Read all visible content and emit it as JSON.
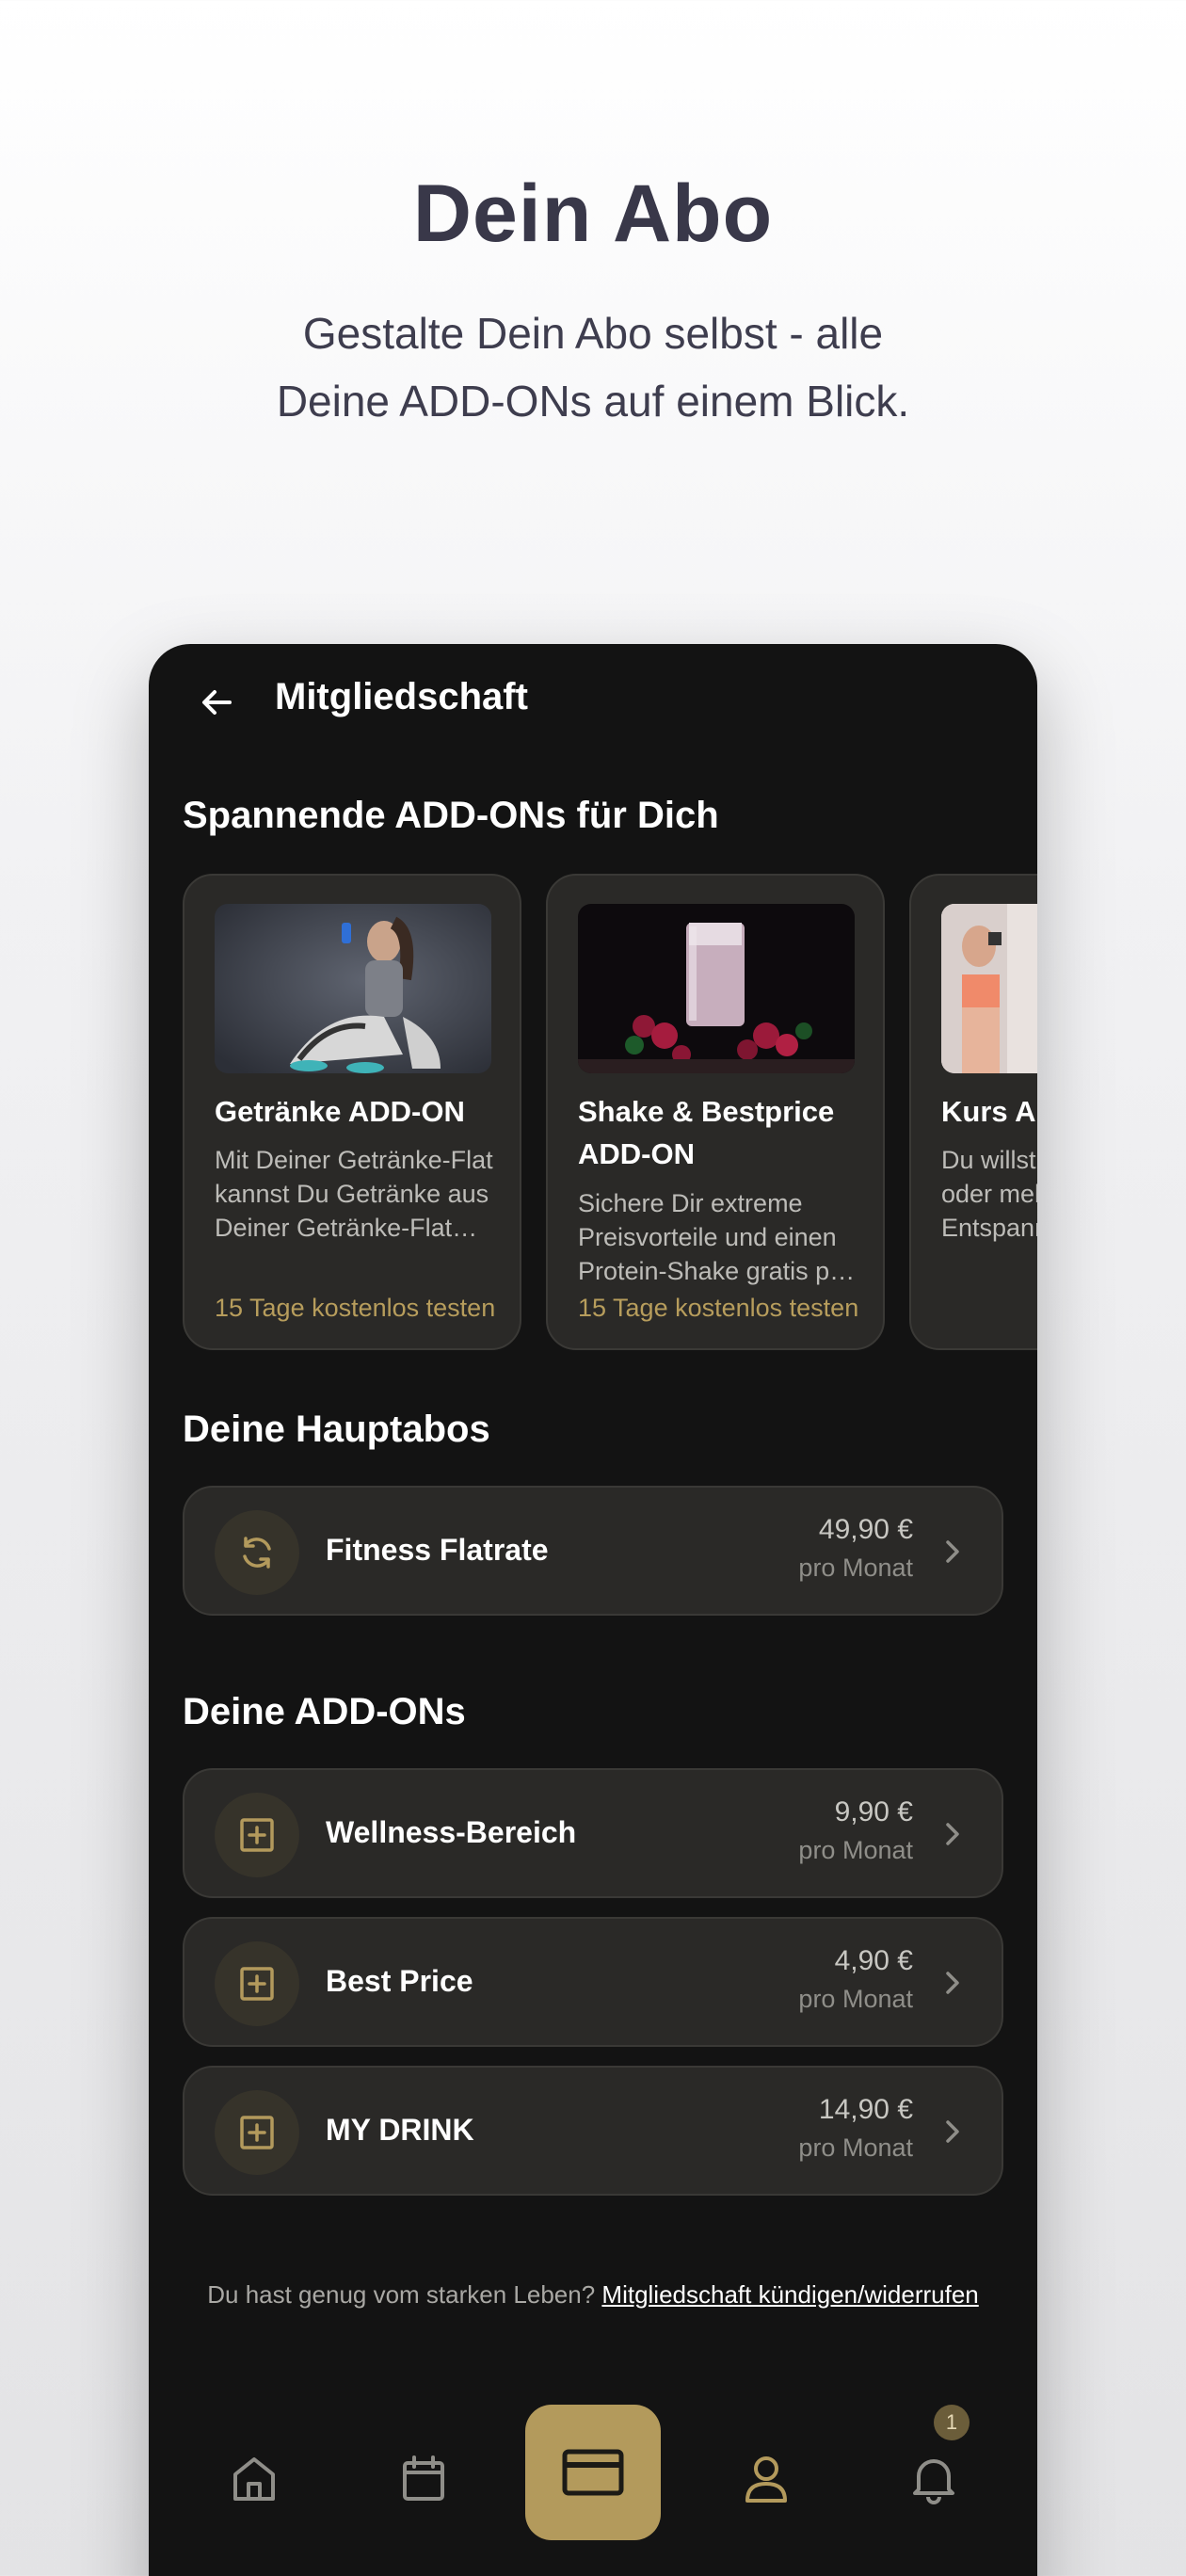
{
  "hero": {
    "title": "Dein Abo",
    "subtitle_line1": "Gestalte Dein Abo selbst - alle",
    "subtitle_line2": "Deine ADD-ONs auf einem Blick."
  },
  "appbar": {
    "title": "Mitgliedschaft",
    "back_icon": "arrow-left-icon"
  },
  "addons_promo": {
    "title": "Spannende ADD-ONs für Dich",
    "cards": [
      {
        "title": "Getränke ADD-ON",
        "description": "Mit Deiner Getränke-Flat kannst Du Getränke aus Deiner Getränke-Flat ganz bequem genießen.",
        "cta": "15 Tage kostenlos testen",
        "image": "woman-drinking-photo"
      },
      {
        "title": "Shake & Bestprice ADD-ON",
        "description": "Sichere Dir extreme Preisvorteile und einen Protein-Shake gratis pro Training.",
        "cta": "15 Tage kostenlos testen",
        "image": "protein-shake-photo"
      },
      {
        "title": "Kurs ADD-ON",
        "description": "Du willst mehr Power oder mehr Entspannung?",
        "cta": "",
        "image": "fitness-class-photo"
      }
    ]
  },
  "main_subscriptions": {
    "title": "Deine Hauptabos",
    "items": [
      {
        "label": "Fitness Flatrate",
        "price": "49,90 €",
        "period": "pro Monat",
        "icon": "refresh-icon"
      }
    ]
  },
  "addons": {
    "title": "Deine ADD-ONs",
    "items": [
      {
        "label": "Wellness-Bereich",
        "price": "9,90 €",
        "period": "pro Monat",
        "icon": "plus-square-icon"
      },
      {
        "label": "Best Price",
        "price": "4,90 €",
        "period": "pro Monat",
        "icon": "plus-square-icon"
      },
      {
        "label": "MY DRINK",
        "price": "14,90 €",
        "period": "pro Monat",
        "icon": "plus-square-icon"
      }
    ]
  },
  "footer": {
    "cancel_text": "Du hast genug vom starken Leben? ",
    "cancel_link": "Mitgliedschaft kündigen/widerrufen"
  },
  "tabbar": {
    "items": [
      {
        "name": "home-icon",
        "active": false
      },
      {
        "name": "calendar-icon",
        "active": false
      },
      {
        "name": "credit-card-icon",
        "active": true
      },
      {
        "name": "user-icon",
        "active": false
      },
      {
        "name": "bell-icon",
        "active": false
      }
    ],
    "notification_count": "1"
  },
  "colors": {
    "accent": "#b39a5c",
    "background": "#131313",
    "card": "#2a2927",
    "hero_text": "#393849"
  }
}
